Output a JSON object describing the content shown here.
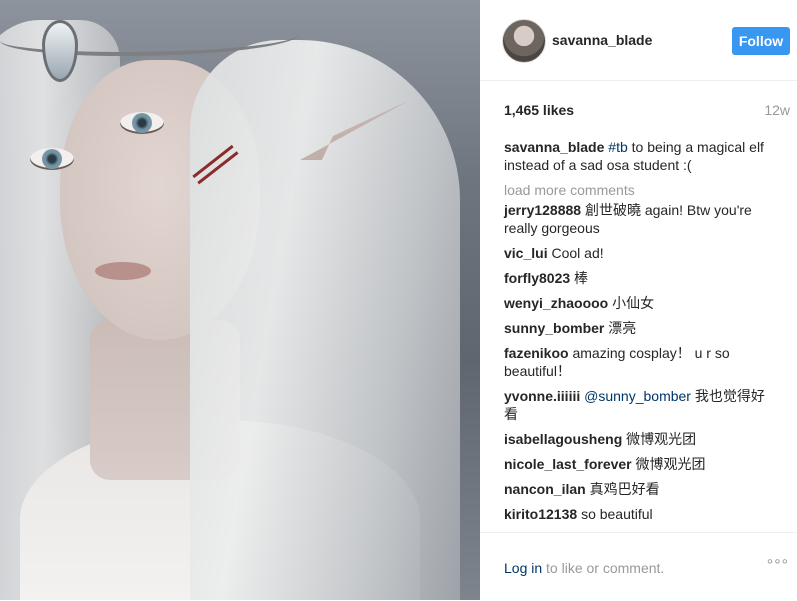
{
  "header": {
    "username": "savanna_blade",
    "follow_label": "Follow"
  },
  "stats": {
    "likes": "1,465 likes",
    "time_ago": "12w"
  },
  "caption": {
    "username": "savanna_blade",
    "hashtag": "#tb",
    "text": " to being a magical elf instead of a sad osa student :("
  },
  "load_more": "load more comments",
  "comments": [
    {
      "user": "jerry128888",
      "text": "創世破曉 again! Btw you're really gorgeous"
    },
    {
      "user": "vic_lui",
      "text": "Cool ad!"
    },
    {
      "user": "forfly8023",
      "text": "棒"
    },
    {
      "user": "wenyi_zhaoooo",
      "text": "小仙女"
    },
    {
      "user": "sunny_bomber",
      "text": "漂亮"
    },
    {
      "user": "fazenikoo",
      "text": "amazing cosplay！ u r so beautiful！"
    },
    {
      "user": "yvonne.iiiiii",
      "mention": "@sunny_bomber",
      "text": " 我也觉得好看"
    },
    {
      "user": "isabellagousheng",
      "text": "微博观光团"
    },
    {
      "user": "nicole_last_forever",
      "text": "微博观光团"
    },
    {
      "user": "nancon_ilan",
      "text": "真鸡巴好看"
    },
    {
      "user": "kirito12138",
      "text": "so beautiful"
    }
  ],
  "footer": {
    "login_link": "Log in",
    "login_text": " to like or comment.",
    "more_icon": "ellipsis-icon",
    "more_glyph": "°°°"
  },
  "colors": {
    "follow_button": "#3897f0",
    "link": "#003569",
    "muted": "#999999"
  }
}
